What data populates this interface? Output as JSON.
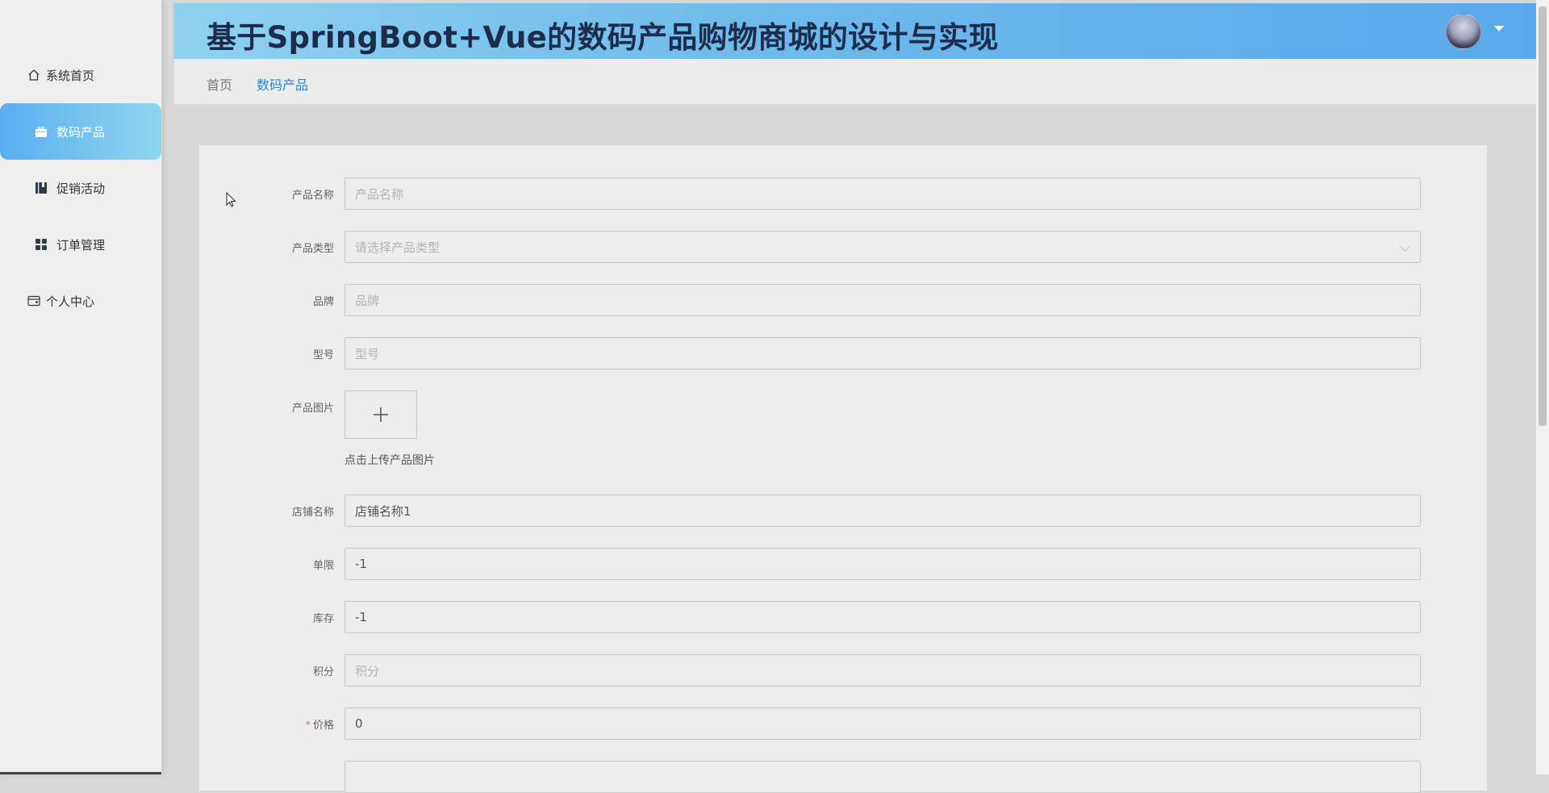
{
  "app": {
    "title": "基于SpringBoot+Vue的数码产品购物商城的设计与实现"
  },
  "sidebar": {
    "items": [
      {
        "label": "系统首页",
        "icon": "home-icon",
        "active": false
      },
      {
        "label": "数码产品",
        "icon": "bag-icon",
        "active": true
      },
      {
        "label": "促销活动",
        "icon": "book-icon",
        "active": false
      },
      {
        "label": "订单管理",
        "icon": "grid-icon",
        "active": false
      },
      {
        "label": "个人中心",
        "icon": "wallet-icon",
        "active": false
      }
    ]
  },
  "breadcrumb": {
    "home": "首页",
    "current": "数码产品"
  },
  "form": {
    "product_name": {
      "label": "产品名称",
      "placeholder": "产品名称",
      "value": ""
    },
    "product_type": {
      "label": "产品类型",
      "placeholder": "请选择产品类型",
      "value": ""
    },
    "brand": {
      "label": "品牌",
      "placeholder": "品牌",
      "value": ""
    },
    "model": {
      "label": "型号",
      "placeholder": "型号",
      "value": ""
    },
    "product_image": {
      "label": "产品图片",
      "hint": "点击上传产品图片",
      "upload_symbol": "+"
    },
    "shop_name": {
      "label": "店铺名称",
      "value": "店铺名称1"
    },
    "single_limit": {
      "label": "单限",
      "value": "-1"
    },
    "stock": {
      "label": "库存",
      "value": "-1"
    },
    "points": {
      "label": "积分",
      "placeholder": "积分",
      "value": ""
    },
    "price": {
      "label": "价格",
      "required_mark": "*",
      "value": "0"
    }
  },
  "colors": {
    "accent": "#2d86c8",
    "header_gradient_start": "#8ed1ee",
    "header_gradient_end": "#5aa9ec",
    "active_nav_start": "#5aaef0",
    "active_nav_end": "#8fd6f0",
    "required": "#f56c6c"
  }
}
